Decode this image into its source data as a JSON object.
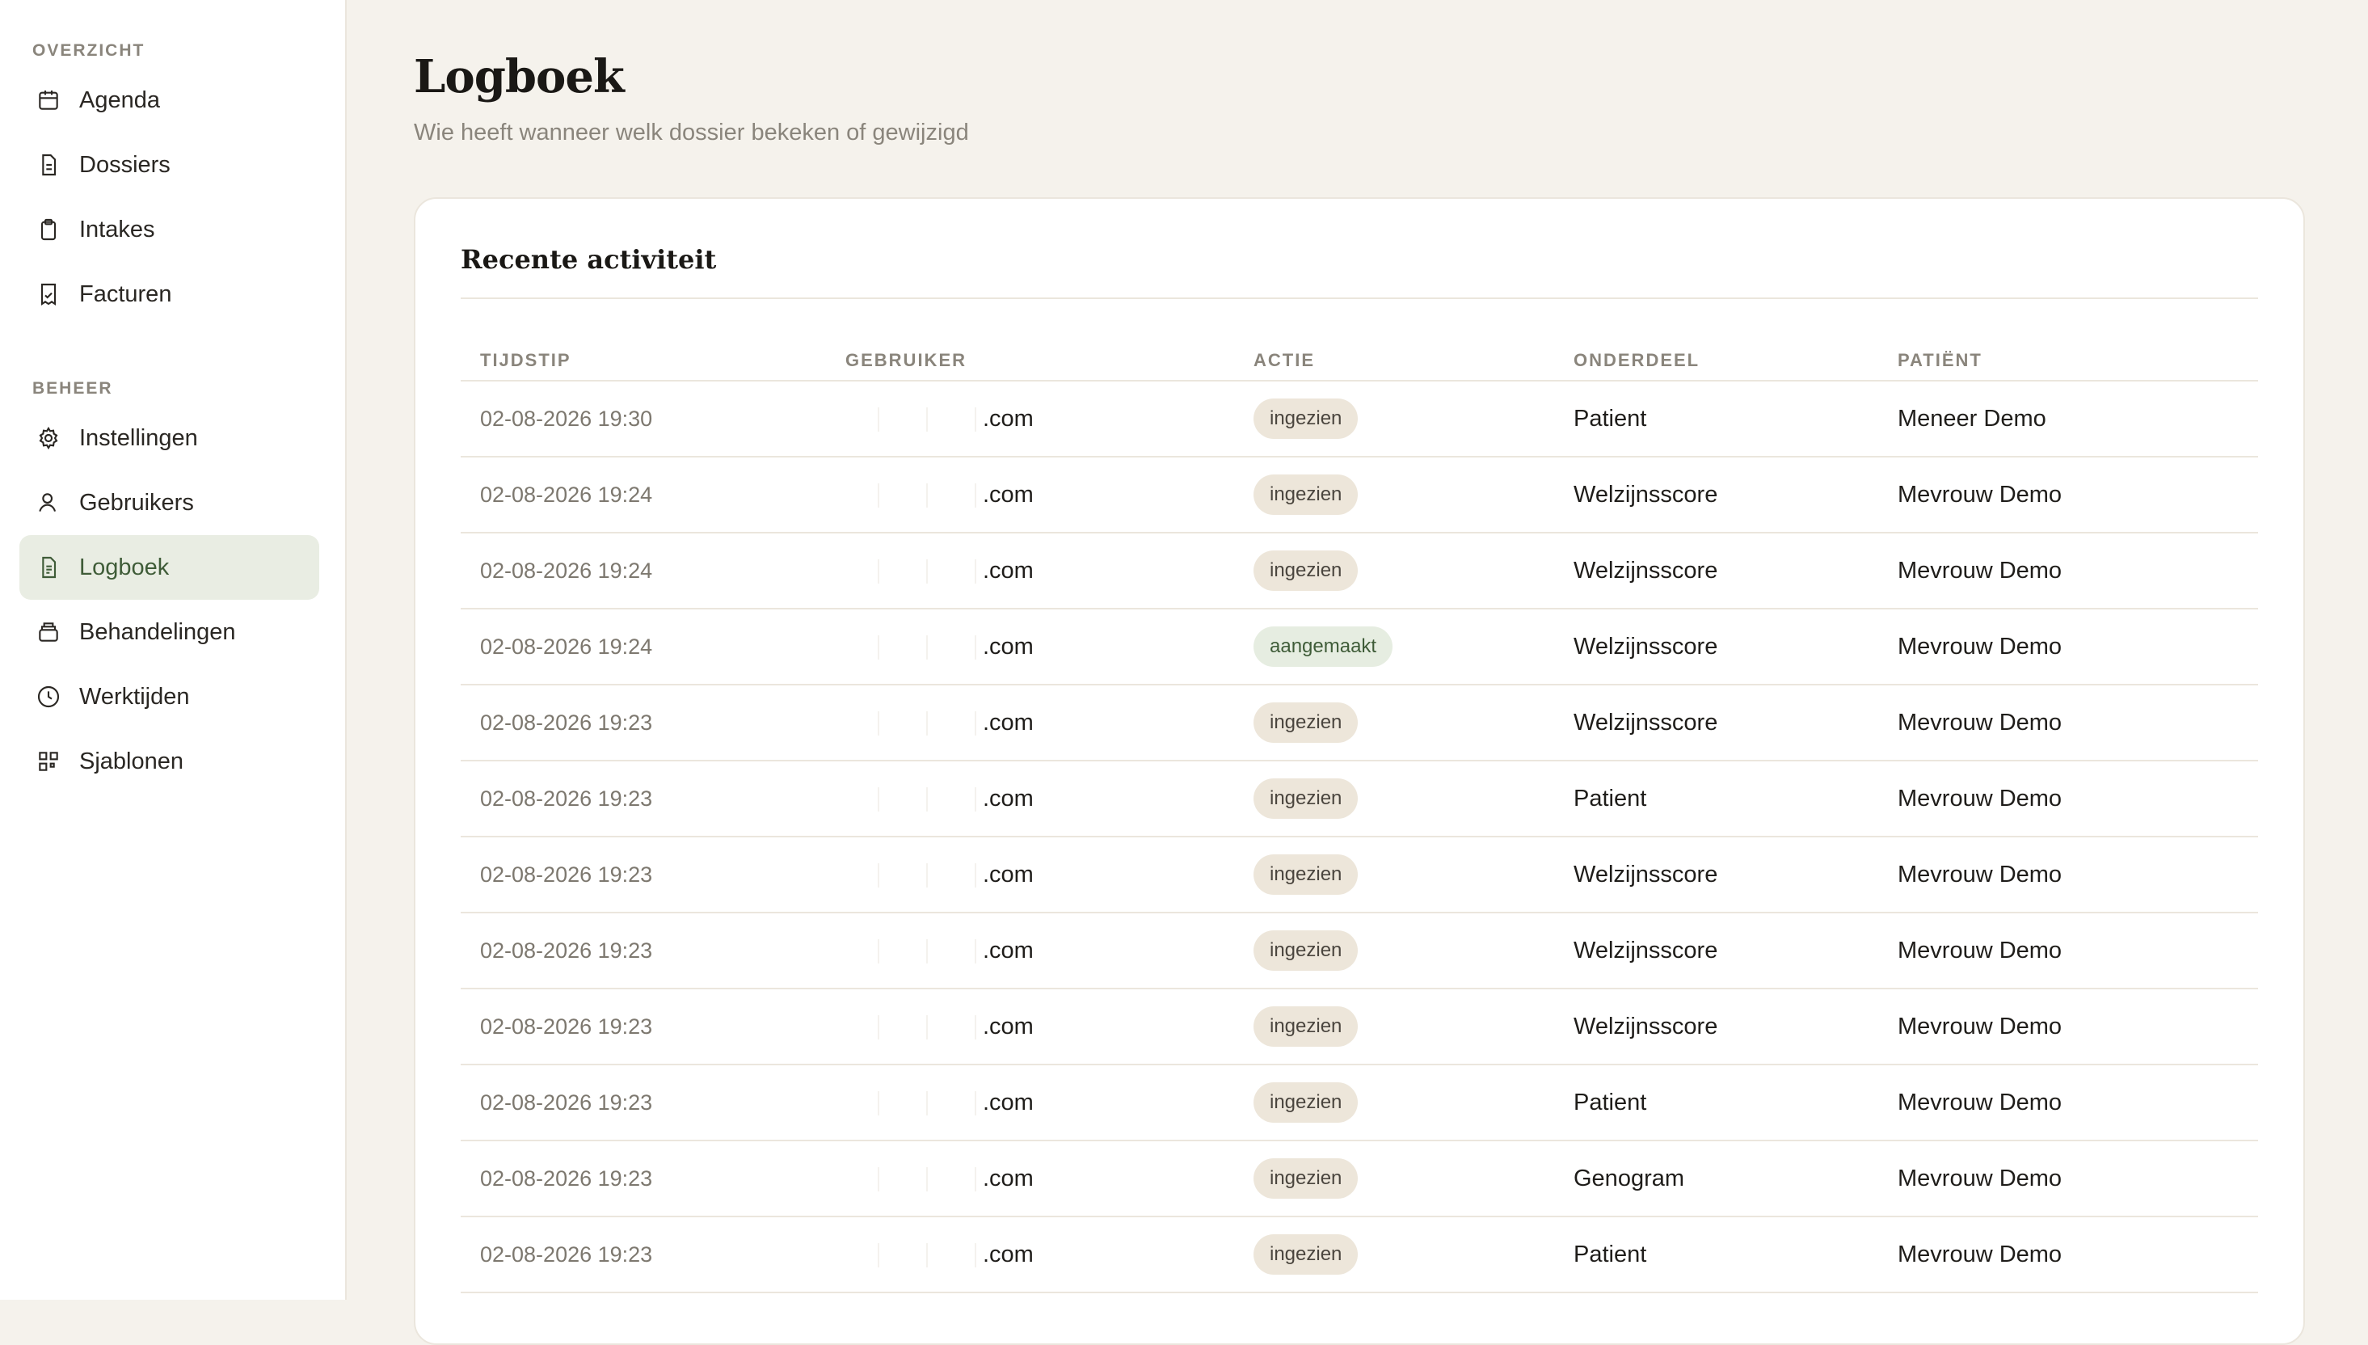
{
  "sidebar": {
    "section_overview": "OVERZICHT",
    "section_manage": "BEHEER",
    "overview_items": [
      {
        "label": "Agenda",
        "icon": "calendar-icon"
      },
      {
        "label": "Dossiers",
        "icon": "file-icon"
      },
      {
        "label": "Intakes",
        "icon": "clipboard-icon"
      },
      {
        "label": "Facturen",
        "icon": "receipt-icon"
      }
    ],
    "manage_items": [
      {
        "label": "Instellingen",
        "icon": "gear-icon"
      },
      {
        "label": "Gebruikers",
        "icon": "user-icon"
      },
      {
        "label": "Logboek",
        "icon": "log-icon",
        "active": true
      },
      {
        "label": "Behandelingen",
        "icon": "stack-icon"
      },
      {
        "label": "Werktijden",
        "icon": "clock-icon"
      },
      {
        "label": "Sjablonen",
        "icon": "grid-icon"
      }
    ]
  },
  "header": {
    "title": "Logboek",
    "subtitle": "Wie heeft wanneer welk dossier bekeken of gewijzigd"
  },
  "card": {
    "title": "Recente activiteit",
    "columns": [
      "TIJDSTIP",
      "GEBRUIKER",
      "ACTIE",
      "ONDERDEEL",
      "PATIËNT"
    ],
    "rows": [
      {
        "time": "02-08-2026 19:30",
        "user": ".com",
        "action": "ingezien",
        "part": "Patient",
        "patient": "Meneer Demo"
      },
      {
        "time": "02-08-2026 19:24",
        "user": ".com",
        "action": "ingezien",
        "part": "Welzijnsscore",
        "patient": "Mevrouw Demo"
      },
      {
        "time": "02-08-2026 19:24",
        "user": ".com",
        "action": "ingezien",
        "part": "Welzijnsscore",
        "patient": "Mevrouw Demo"
      },
      {
        "time": "02-08-2026 19:24",
        "user": ".com",
        "action": "aangemaakt",
        "part": "Welzijnsscore",
        "patient": "Mevrouw Demo"
      },
      {
        "time": "02-08-2026 19:23",
        "user": ".com",
        "action": "ingezien",
        "part": "Welzijnsscore",
        "patient": "Mevrouw Demo"
      },
      {
        "time": "02-08-2026 19:23",
        "user": ".com",
        "action": "ingezien",
        "part": "Patient",
        "patient": "Mevrouw Demo"
      },
      {
        "time": "02-08-2026 19:23",
        "user": ".com",
        "action": "ingezien",
        "part": "Welzijnsscore",
        "patient": "Mevrouw Demo"
      },
      {
        "time": "02-08-2026 19:23",
        "user": ".com",
        "action": "ingezien",
        "part": "Welzijnsscore",
        "patient": "Mevrouw Demo"
      },
      {
        "time": "02-08-2026 19:23",
        "user": ".com",
        "action": "ingezien",
        "part": "Welzijnsscore",
        "patient": "Mevrouw Demo"
      },
      {
        "time": "02-08-2026 19:23",
        "user": ".com",
        "action": "ingezien",
        "part": "Patient",
        "patient": "Mevrouw Demo"
      },
      {
        "time": "02-08-2026 19:23",
        "user": ".com",
        "action": "ingezien",
        "part": "Genogram",
        "patient": "Mevrouw Demo"
      },
      {
        "time": "02-08-2026 19:23",
        "user": ".com",
        "action": "ingezien",
        "part": "Patient",
        "patient": "Mevrouw Demo"
      }
    ]
  },
  "colors": {
    "background": "#f5f2ec",
    "active_nav": "#e9ede3",
    "accent_green": "#3f5c38",
    "badge_view": "#ede6da",
    "badge_create": "#e6ede1"
  }
}
